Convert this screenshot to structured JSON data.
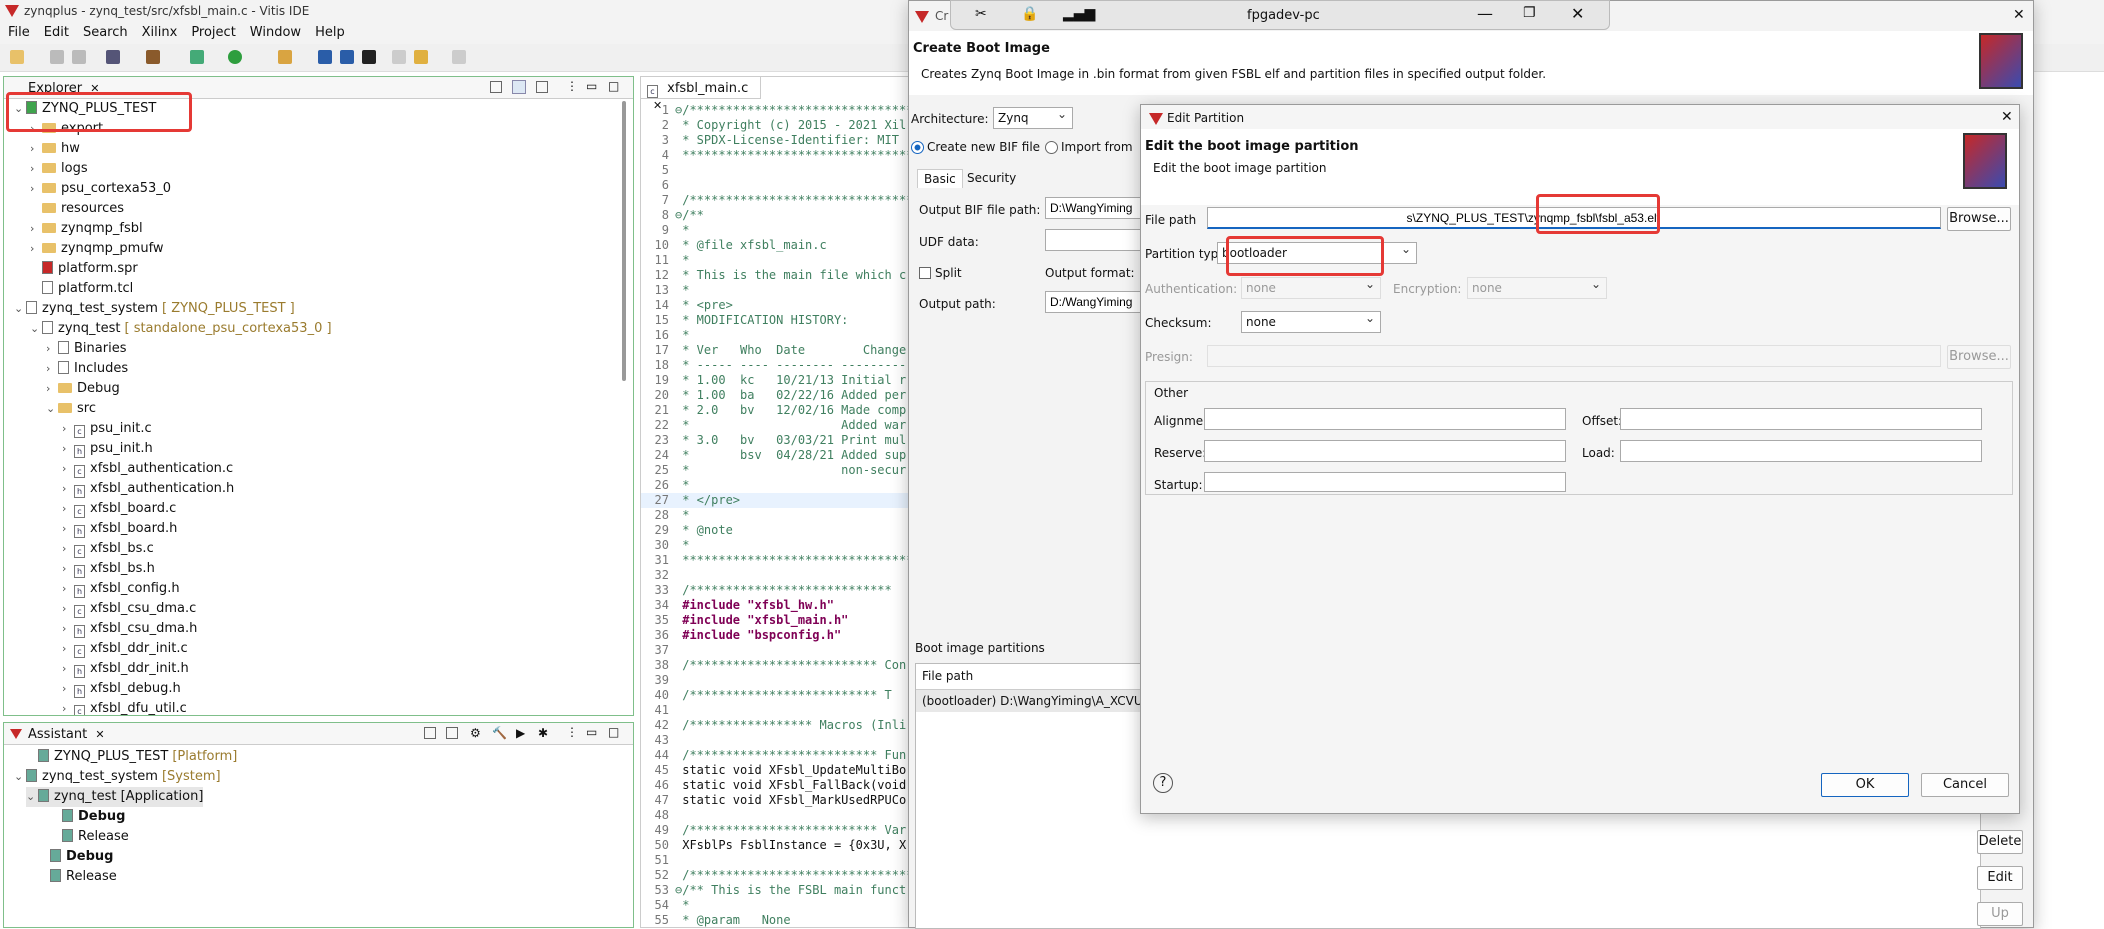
{
  "app": {
    "title": "zynqplus - zynq_test/src/xfsbl_main.c - Vitis IDE"
  },
  "menu": [
    "File",
    "Edit",
    "Search",
    "Xilinx",
    "Project",
    "Window",
    "Help"
  ],
  "explorer": {
    "tab": "Explorer",
    "items": [
      {
        "label": "ZYNQ_PLUS_TEST",
        "extra": "",
        "indent": 0,
        "chev": "⌄",
        "icon": "platform"
      },
      {
        "label": "export",
        "extra": "",
        "indent": 1,
        "chev": "›",
        "icon": "folder"
      },
      {
        "label": "hw",
        "extra": "",
        "indent": 1,
        "chev": "›",
        "icon": "folder"
      },
      {
        "label": "logs",
        "extra": "",
        "indent": 1,
        "chev": "›",
        "icon": "folder"
      },
      {
        "label": "psu_cortexa53_0",
        "extra": "",
        "indent": 1,
        "chev": "›",
        "icon": "folder"
      },
      {
        "label": "resources",
        "extra": "",
        "indent": 1,
        "chev": "",
        "icon": "folder"
      },
      {
        "label": "zynqmp_fsbl",
        "extra": "",
        "indent": 1,
        "chev": "›",
        "icon": "folder"
      },
      {
        "label": "zynqmp_pmufw",
        "extra": "",
        "indent": 1,
        "chev": "›",
        "icon": "folder"
      },
      {
        "label": "platform.spr",
        "extra": "",
        "indent": 1,
        "chev": "",
        "icon": "spr"
      },
      {
        "label": "platform.tcl",
        "extra": "",
        "indent": 1,
        "chev": "",
        "icon": "file"
      },
      {
        "label": "zynq_test_system",
        "extra": "[ ZYNQ_PLUS_TEST ]",
        "indent": 0,
        "chev": "⌄",
        "icon": "system"
      },
      {
        "label": "zynq_test",
        "extra": "[ standalone_psu_cortexa53_0 ]",
        "indent": 1,
        "chev": "⌄",
        "icon": "app"
      },
      {
        "label": "Binaries",
        "extra": "",
        "indent": 2,
        "chev": "›",
        "icon": "bin"
      },
      {
        "label": "Includes",
        "extra": "",
        "indent": 2,
        "chev": "›",
        "icon": "inc"
      },
      {
        "label": "Debug",
        "extra": "",
        "indent": 2,
        "chev": "›",
        "icon": "folder"
      },
      {
        "label": "src",
        "extra": "",
        "indent": 2,
        "chev": "⌄",
        "icon": "folder"
      },
      {
        "label": "psu_init.c",
        "extra": "",
        "indent": 3,
        "chev": "›",
        "icon": "c"
      },
      {
        "label": "psu_init.h",
        "extra": "",
        "indent": 3,
        "chev": "›",
        "icon": "h"
      },
      {
        "label": "xfsbl_authentication.c",
        "extra": "",
        "indent": 3,
        "chev": "›",
        "icon": "c"
      },
      {
        "label": "xfsbl_authentication.h",
        "extra": "",
        "indent": 3,
        "chev": "›",
        "icon": "h"
      },
      {
        "label": "xfsbl_board.c",
        "extra": "",
        "indent": 3,
        "chev": "›",
        "icon": "c"
      },
      {
        "label": "xfsbl_board.h",
        "extra": "",
        "indent": 3,
        "chev": "›",
        "icon": "h"
      },
      {
        "label": "xfsbl_bs.c",
        "extra": "",
        "indent": 3,
        "chev": "›",
        "icon": "c"
      },
      {
        "label": "xfsbl_bs.h",
        "extra": "",
        "indent": 3,
        "chev": "›",
        "icon": "h"
      },
      {
        "label": "xfsbl_config.h",
        "extra": "",
        "indent": 3,
        "chev": "›",
        "icon": "h"
      },
      {
        "label": "xfsbl_csu_dma.c",
        "extra": "",
        "indent": 3,
        "chev": "›",
        "icon": "c"
      },
      {
        "label": "xfsbl_csu_dma.h",
        "extra": "",
        "indent": 3,
        "chev": "›",
        "icon": "h"
      },
      {
        "label": "xfsbl_ddr_init.c",
        "extra": "",
        "indent": 3,
        "chev": "›",
        "icon": "c"
      },
      {
        "label": "xfsbl_ddr_init.h",
        "extra": "",
        "indent": 3,
        "chev": "›",
        "icon": "h"
      },
      {
        "label": "xfsbl_debug.h",
        "extra": "",
        "indent": 3,
        "chev": "›",
        "icon": "h"
      },
      {
        "label": "xfsbl_dfu_util.c",
        "extra": "",
        "indent": 3,
        "chev": "›",
        "icon": "c"
      }
    ]
  },
  "assistant": {
    "tab": "Assistant",
    "items": [
      {
        "label": "ZYNQ_PLUS_TEST",
        "extra": "[Platform]",
        "indent": 1,
        "chev": "",
        "bold": false
      },
      {
        "label": "zynq_test_system",
        "extra": "[System]",
        "indent": 0,
        "chev": "⌄",
        "bold": false
      },
      {
        "label": "zynq_test [Application]",
        "extra": "",
        "indent": 1,
        "chev": "⌄",
        "bold": false
      },
      {
        "label": "Debug",
        "extra": "",
        "indent": 3,
        "chev": "",
        "bold": true
      },
      {
        "label": "Release",
        "extra": "",
        "indent": 3,
        "chev": "",
        "bold": false
      },
      {
        "label": "Debug",
        "extra": "",
        "indent": 2,
        "chev": "",
        "bold": true
      },
      {
        "label": "Release",
        "extra": "",
        "indent": 2,
        "chev": "",
        "bold": false
      }
    ]
  },
  "editor": {
    "tab": "xfsbl_main.c",
    "lines": [
      [
        "1",
        "⊖/****************************************"
      ],
      [
        "2",
        " * Copyright (c) 2015 - 2021 Xil"
      ],
      [
        "3",
        " * SPDX-License-Identifier: MIT"
      ],
      [
        "4",
        " ****************************************"
      ],
      [
        "5",
        ""
      ],
      [
        "6",
        ""
      ],
      [
        "7",
        " /****************************************"
      ],
      [
        "8",
        "⊖/**"
      ],
      [
        "9",
        " *"
      ],
      [
        "10",
        " * @file xfsbl_main.c"
      ],
      [
        "11",
        " *"
      ],
      [
        "12",
        " * This is the main file which c"
      ],
      [
        "13",
        " *"
      ],
      [
        "14",
        " * <pre>"
      ],
      [
        "15",
        " * MODIFICATION HISTORY:"
      ],
      [
        "16",
        " *"
      ],
      [
        "17",
        " * Ver   Who  Date        Change"
      ],
      [
        "18",
        " * ----- ---- -------- ---------"
      ],
      [
        "19",
        " * 1.00  kc   10/21/13 Initial r"
      ],
      [
        "20",
        " * 1.00  ba   02/22/16 Added per"
      ],
      [
        "21",
        " * 2.0   bv   12/02/16 Made comp"
      ],
      [
        "22",
        " *                     Added war"
      ],
      [
        "23",
        " * 3.0   bv   03/03/21 Print mul"
      ],
      [
        "24",
        " *       bsv  04/28/21 Added sup"
      ],
      [
        "25",
        " *                     non-secur"
      ],
      [
        "26",
        " *"
      ],
      [
        "27",
        " * </pre>"
      ],
      [
        "28",
        " *"
      ],
      [
        "29",
        " * @note"
      ],
      [
        "30",
        " *"
      ],
      [
        "31",
        " ****************************************"
      ],
      [
        "32",
        ""
      ],
      [
        "33",
        " /****************************"
      ],
      [
        "34",
        " #include \"xfsbl_hw.h\""
      ],
      [
        "35",
        " #include \"xfsbl_main.h\""
      ],
      [
        "36",
        " #include \"bspconfig.h\""
      ],
      [
        "37",
        ""
      ],
      [
        "38",
        " /************************** Con"
      ],
      [
        "39",
        ""
      ],
      [
        "40",
        " /************************** T"
      ],
      [
        "41",
        ""
      ],
      [
        "42",
        " /***************** Macros (Inli"
      ],
      [
        "43",
        ""
      ],
      [
        "44",
        " /************************** Fun"
      ],
      [
        "45",
        " static void XFsbl_UpdateMultiBo"
      ],
      [
        "46",
        " static void XFsbl_FallBack(void"
      ],
      [
        "47",
        " static void XFsbl_MarkUsedRPUCo"
      ],
      [
        "48",
        ""
      ],
      [
        "49",
        " /************************** Var"
      ],
      [
        "50",
        " XFsblPs FsblInstance = {0x3U, X"
      ],
      [
        "51",
        ""
      ],
      [
        "52",
        " /****************************************"
      ],
      [
        "53",
        "⊖/** This is the FSBL main funct"
      ],
      [
        "54",
        " *"
      ],
      [
        "55",
        " * @param   None"
      ]
    ]
  },
  "remote": {
    "title": "fpgadev-pc"
  },
  "boot": {
    "title_short": "Cr",
    "heading": "Create Boot Image",
    "desc": "Creates Zynq Boot Image in .bin format from given FSBL elf and partition files in specified output folder.",
    "arch_label": "Architecture:",
    "arch_value": "Zynq",
    "radio_new": "Create new BIF file",
    "radio_import": "Import from",
    "tab_basic": "Basic",
    "tab_security": "Security",
    "bif_label": "Output BIF file path:",
    "bif_value": "D:\\WangYiming",
    "udf_label": "UDF data:",
    "split_label": "Split",
    "format_label": "Output format:",
    "outpath_label": "Output path:",
    "outpath_value": "D:/WangYiming",
    "partitions_label": "Boot image partitions",
    "col_filepath": "File path",
    "partition_row": "(bootloader) D:\\WangYiming\\A_XCVU",
    "btn_delete": "Delete",
    "btn_edit": "Edit",
    "btn_up": "Up"
  },
  "edit": {
    "title": "Edit Partition",
    "heading": "Edit the boot image partition",
    "desc": "Edit the boot image partition",
    "file_label": "File path",
    "file_value": "s\\ZYNQ_PLUS_TEST\\zynqmp_fsbl\\fsbl_a53.elf",
    "browse": "Browse...",
    "ptype_label": "Partition type:",
    "ptype_value": "bootloader",
    "auth_label": "Authentication:",
    "auth_value": "none",
    "enc_label": "Encryption:",
    "enc_value": "none",
    "checksum_label": "Checksum:",
    "checksum_value": "none",
    "presign_label": "Presign:",
    "presign_browse": "Browse...",
    "other": "Other",
    "alignment": "Alignment:",
    "offset": "Offset:",
    "reserve": "Reserve:",
    "load": "Load:",
    "startup": "Startup:",
    "ok": "OK",
    "cancel": "Cancel",
    "help": "?"
  }
}
